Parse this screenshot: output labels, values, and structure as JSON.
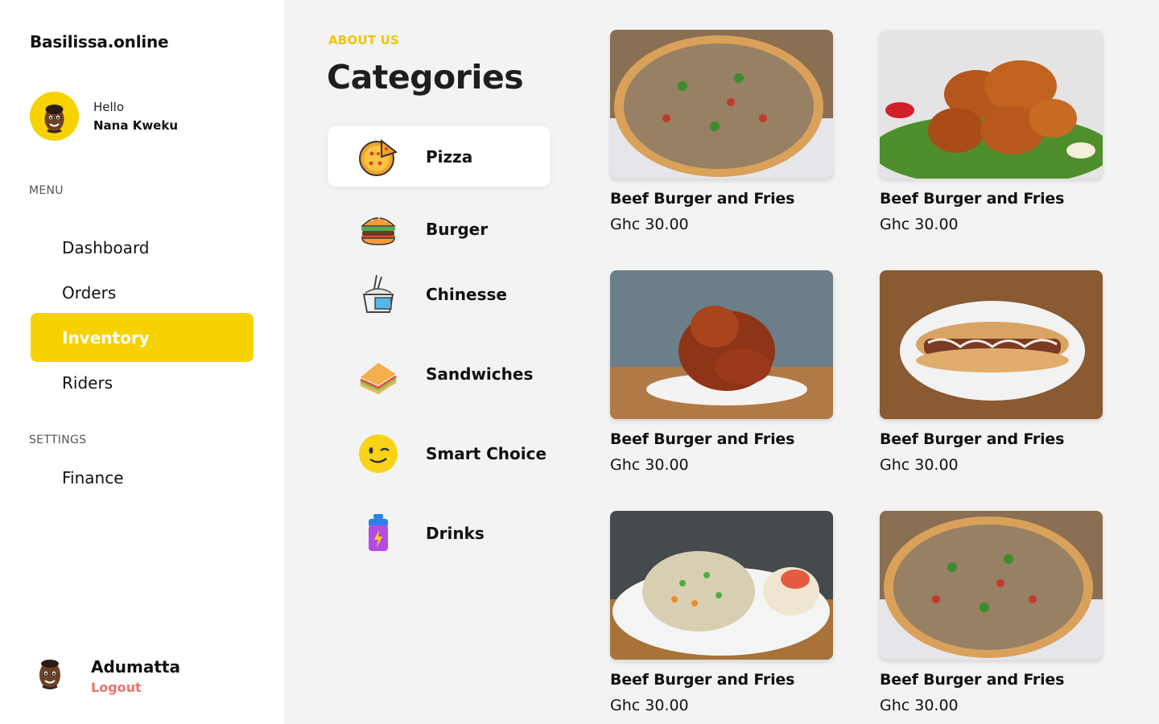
{
  "brand": "Basilissa.online",
  "profile": {
    "greeting": "Hello",
    "name": "Nana Kweku"
  },
  "menu_label": "MENU",
  "menu": [
    {
      "label": "Dashboard",
      "active": false
    },
    {
      "label": "Orders",
      "active": false
    },
    {
      "label": "Inventory",
      "active": true
    },
    {
      "label": "Riders",
      "active": false
    }
  ],
  "settings_label": "SETTINGS",
  "settings": [
    {
      "label": "Finance"
    }
  ],
  "user": {
    "name": "Adumatta",
    "logout": "Logout"
  },
  "categories": {
    "eyebrow": "ABOUT US",
    "title": "Categories",
    "items": [
      {
        "label": "Pizza",
        "icon": "pizza-icon",
        "active": true
      },
      {
        "label": "Burger",
        "icon": "burger-icon",
        "active": false
      },
      {
        "label": "Chinesse",
        "icon": "takeout-box-icon",
        "active": false
      },
      {
        "label": "Sandwiches",
        "icon": "sandwich-icon",
        "active": false
      },
      {
        "label": "Smart Choice",
        "icon": "winking-face-icon",
        "active": false
      },
      {
        "label": "Drinks",
        "icon": "drink-bottle-icon",
        "active": false
      }
    ]
  },
  "products": [
    {
      "name": "Beef Burger and Fries",
      "price": "Ghc 30.00",
      "image": "pizza"
    },
    {
      "name": "Beef Burger and Fries",
      "price": "Ghc 30.00",
      "image": "fried-chicken"
    },
    {
      "name": "Beef Burger and Fries",
      "price": "Ghc 30.00",
      "image": "spicy-wings"
    },
    {
      "name": "Beef Burger and Fries",
      "price": "Ghc 30.00",
      "image": "sub-sandwich"
    },
    {
      "name": "Beef Burger and Fries",
      "price": "Ghc 30.00",
      "image": "fried-rice"
    },
    {
      "name": "Beef Burger and Fries",
      "price": "Ghc 30.00",
      "image": "pizza"
    }
  ],
  "colors": {
    "accent": "#f6d200",
    "logout": "#f0706a",
    "eyebrow": "#f3c300"
  }
}
